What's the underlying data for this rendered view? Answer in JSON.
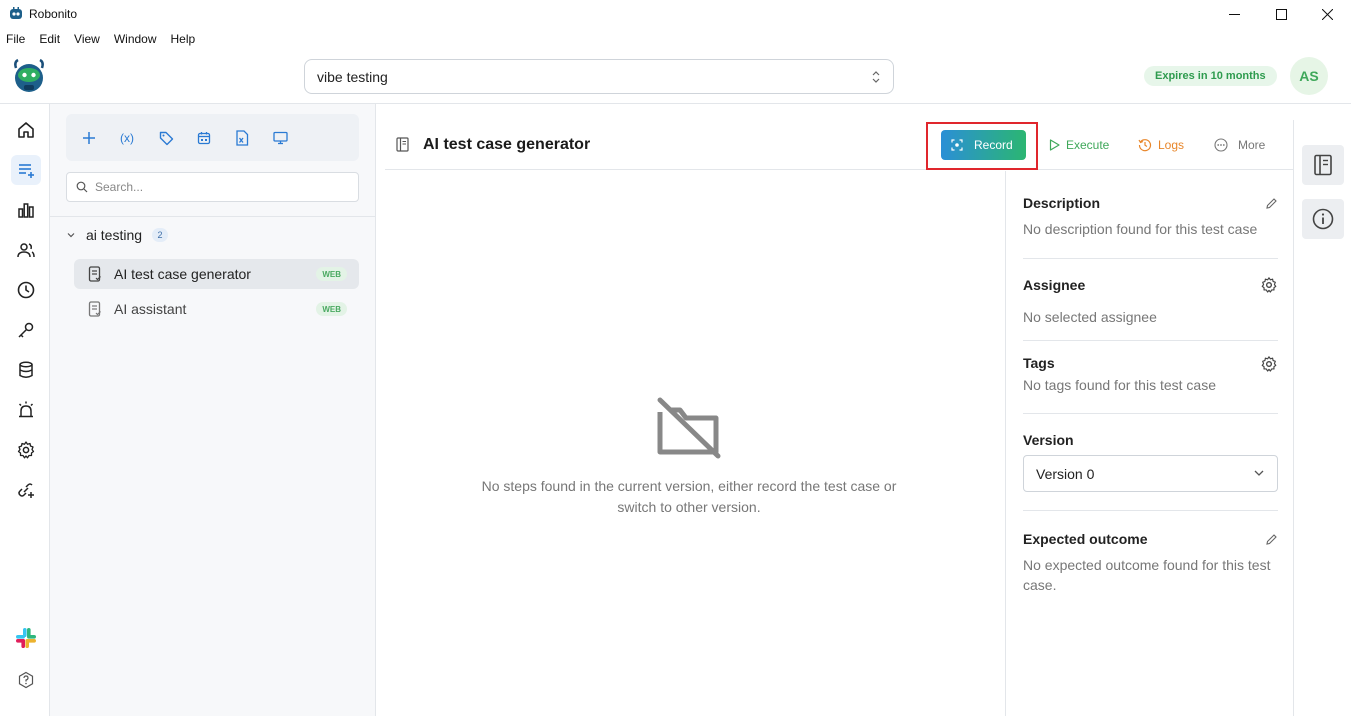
{
  "window": {
    "title": "Robonito",
    "controls": [
      "minimize-icon",
      "maximize-icon",
      "close-icon"
    ]
  },
  "menu": {
    "items": [
      "File",
      "Edit",
      "View",
      "Window",
      "Help"
    ]
  },
  "header": {
    "project_select_value": "vibe testing",
    "expires_badge": "Expires in 10 months",
    "avatar_initials": "AS",
    "accent_green": "#2e9b4e"
  },
  "nav_rail": {
    "icons": [
      "home-icon",
      "test-cases-icon",
      "reports-icon",
      "users-icon",
      "history-icon",
      "keys-icon",
      "database-icon",
      "alerts-icon",
      "settings-icon",
      "integrations-icon",
      "slack-icon",
      "help-icon"
    ],
    "active": "test-cases-icon"
  },
  "explorer": {
    "toolbar_icons": [
      "add-icon",
      "variables-icon",
      "tag-icon",
      "calendar-icon",
      "excel-icon",
      "monitor-icon"
    ],
    "variables_label": "(x)",
    "search_placeholder": "Search...",
    "folder": {
      "label": "ai testing",
      "count": "2"
    },
    "test_cases": [
      {
        "label": "AI test case generator",
        "badge": "WEB",
        "selected": true
      },
      {
        "label": "AI assistant",
        "badge": "WEB",
        "selected": false
      }
    ]
  },
  "main": {
    "title": "AI test case generator",
    "actions": {
      "record": "Record",
      "execute": "Execute",
      "logs": "Logs",
      "more": "More"
    },
    "action_colors": {
      "execute": "#3fa85a",
      "logs": "#e8862a",
      "more": "#777777"
    },
    "empty_message": "No steps found in the current version, either record the test case or switch to other version."
  },
  "details": {
    "description": {
      "title": "Description",
      "text": "No description found for this test case"
    },
    "assignee": {
      "title": "Assignee",
      "text": "No selected assignee"
    },
    "tags": {
      "title": "Tags",
      "text": "No tags found for this test case"
    },
    "version": {
      "title": "Version",
      "value": "Version 0"
    },
    "expected_outcome": {
      "title": "Expected outcome",
      "text": "No expected outcome found for this test case."
    }
  },
  "right_rail": {
    "icons": [
      "notebook-icon",
      "info-icon"
    ]
  }
}
